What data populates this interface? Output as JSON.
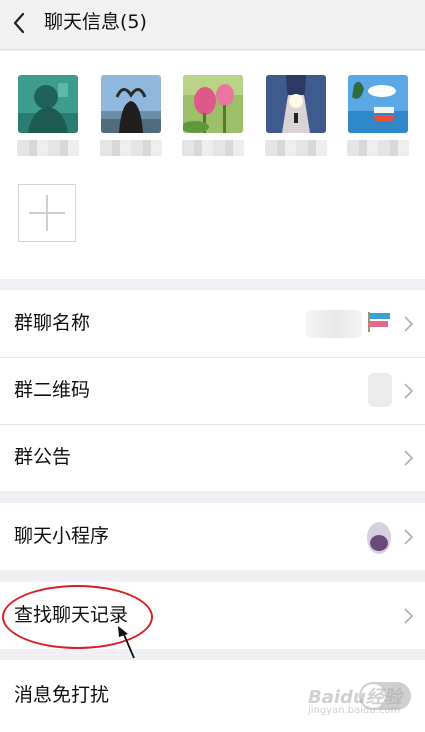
{
  "header": {
    "title": "聊天信息(5)"
  },
  "members": [
    {
      "avatar": "man-silhouette-photo"
    },
    {
      "avatar": "girl-heart-hands-photo"
    },
    {
      "avatar": "lotus-flowers-photo"
    },
    {
      "avatar": "city-street-photo"
    },
    {
      "avatar": "seaside-cartoon-photo"
    }
  ],
  "settings": {
    "group_name_label": "群聊名称",
    "qr_code_label": "群二维码",
    "announcement_label": "群公告",
    "mini_programs_label": "聊天小程序",
    "search_history_label": "查找聊天记录",
    "mute_label": "消息免打扰",
    "mute_enabled": false
  },
  "watermark": {
    "brand": "Baidu经验",
    "url": "jingyan.baidu.com"
  },
  "colors": {
    "annotation": "#d81f26",
    "background": "#efeff4",
    "toggle_off": "#cfcfcf"
  }
}
